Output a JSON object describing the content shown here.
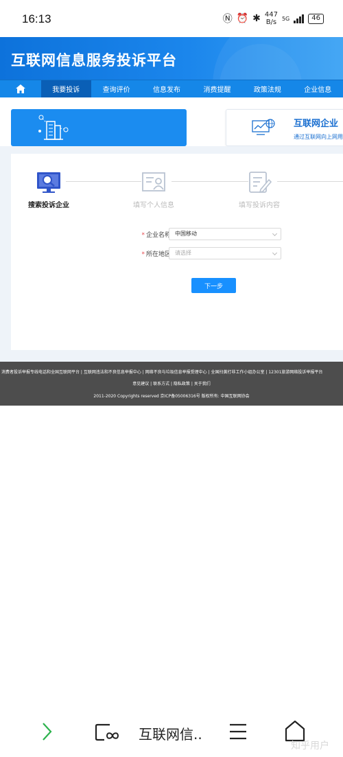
{
  "status_bar": {
    "time": "16:13",
    "net_speed_value": "447",
    "net_speed_unit": "B/s",
    "network_type": "5G",
    "battery": "46"
  },
  "banner": {
    "title": "互联网信息服务投诉平台"
  },
  "nav": {
    "items": [
      {
        "label": "我要投诉",
        "active": true
      },
      {
        "label": "查询评价"
      },
      {
        "label": "信息发布"
      },
      {
        "label": "消费提醒"
      },
      {
        "label": "政策法规"
      },
      {
        "label": "企业信息"
      }
    ]
  },
  "cards": {
    "right_title": "互联网企业",
    "right_subtitle": "通过互联网向上网用户"
  },
  "steps": [
    {
      "label": "搜索投诉企业",
      "active": true
    },
    {
      "label": "填写个人信息"
    },
    {
      "label": "填写投诉内容"
    }
  ],
  "form": {
    "company_label": "企业名称:",
    "company_value": "中国移动",
    "region_label": "所在地区:",
    "region_placeholder": "请选择",
    "required_mark": "*",
    "next_button": "下一步"
  },
  "footer": {
    "links": "消费者投诉举报专线电话和全国互联网平台 | 互联网违法和不良信息举报中心 | 网络不良与垃圾信息举报受理中心 | 全国扫黄打非工作小组办公室 | 12301旅游网络投诉举报平台",
    "links2": "意见建议 | 联系方式 | 隐私政策 | 关于我们",
    "copyright": "2011-2020 Copyrights reserved 京ICP备05006316号 版权所有: 中国互联网协会"
  },
  "browser_bar": {
    "tab_title": "互联网信..",
    "watermark": "知乎用户"
  },
  "colors": {
    "primary": "#1890ff",
    "nav_bg": "#1587e8",
    "nav_active": "#0a5fb6",
    "footer_bg": "#4d4d4d",
    "required": "#e5484d"
  }
}
